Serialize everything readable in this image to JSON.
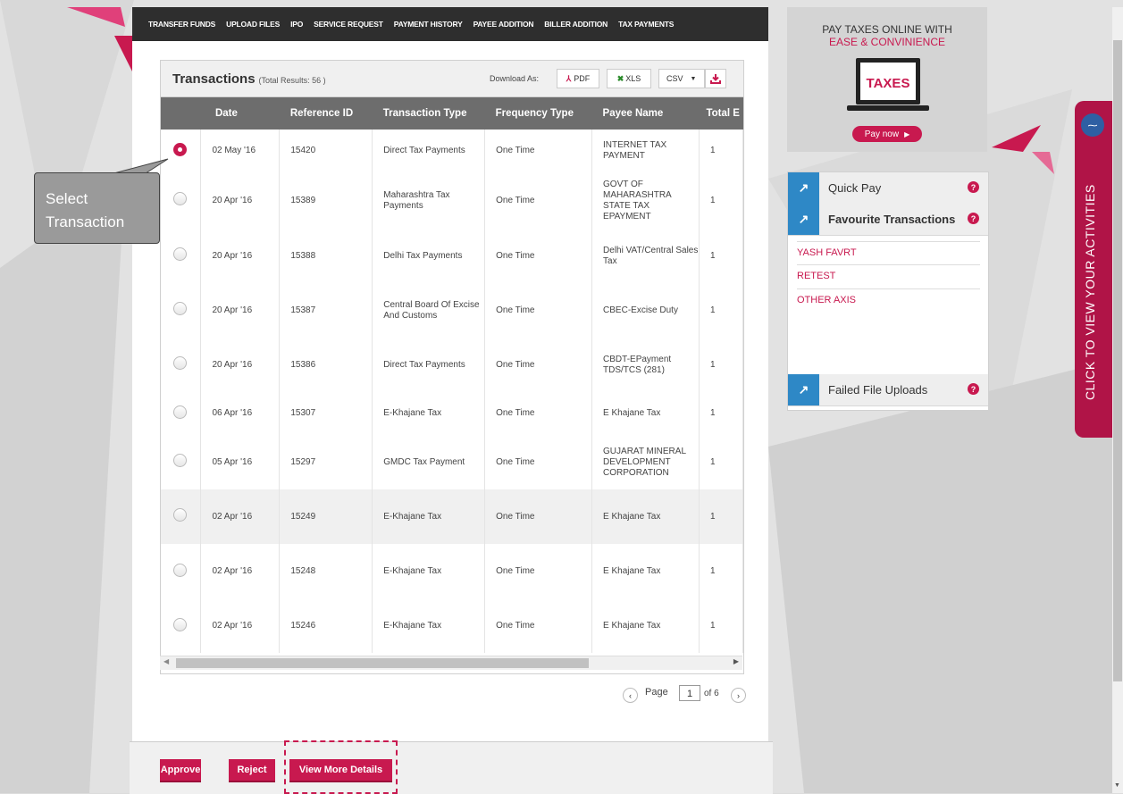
{
  "nav": {
    "items": [
      "TRANSFER FUNDS",
      "UPLOAD FILES",
      "IPO",
      "SERVICE REQUEST",
      "PAYMENT HISTORY",
      "PAYEE ADDITION",
      "BILLER ADDITION",
      "TAX PAYMENTS"
    ],
    "active": "TAX PAYMENTS"
  },
  "transactions": {
    "title": "Transactions",
    "count_label": "(Total Results: 56 )",
    "download_label": "Download As:",
    "pdf_label": "PDF",
    "xls_label": "XLS",
    "csv_label": "CSV",
    "columns": [
      "Date",
      "Reference ID",
      "Transaction Type",
      "Frequency Type",
      "Payee Name",
      "Total E"
    ],
    "rows": [
      {
        "date": "02 May '16",
        "ref": "15420",
        "type": "Direct Tax Payments",
        "freq": "One Time",
        "payee": "INTERNET TAX PAYMENT",
        "total": "1",
        "selected": true
      },
      {
        "date": "20 Apr '16",
        "ref": "15389",
        "type": "Maharashtra Tax Payments",
        "freq": "One Time",
        "payee": "GOVT OF MAHARASHTRA STATE TAX EPAYMENT",
        "total": "1",
        "selected": false
      },
      {
        "date": "20 Apr '16",
        "ref": "15388",
        "type": "Delhi Tax Payments",
        "freq": "One Time",
        "payee": "Delhi VAT/Central Sales Tax",
        "total": "1",
        "selected": false
      },
      {
        "date": "20 Apr '16",
        "ref": "15387",
        "type": "Central Board Of Excise And Customs",
        "freq": "One Time",
        "payee": "CBEC-Excise Duty",
        "total": "1",
        "selected": false
      },
      {
        "date": "20 Apr '16",
        "ref": "15386",
        "type": "Direct Tax Payments",
        "freq": "One Time",
        "payee": "CBDT-EPayment TDS/TCS (281)",
        "total": "1",
        "selected": false
      },
      {
        "date": "06 Apr '16",
        "ref": "15307",
        "type": "E-Khajane Tax",
        "freq": "One Time",
        "payee": "E Khajane Tax",
        "total": "1",
        "selected": false
      },
      {
        "date": "05 Apr '16",
        "ref": "15297",
        "type": "GMDC Tax Payment",
        "freq": "One Time",
        "payee": "GUJARAT MINERAL DEVELOPMENT CORPORATION",
        "total": "1",
        "selected": false
      },
      {
        "date": "02 Apr '16",
        "ref": "15249",
        "type": "E-Khajane Tax",
        "freq": "One Time",
        "payee": "E Khajane Tax",
        "total": "1",
        "selected": false
      },
      {
        "date": "02 Apr '16",
        "ref": "15248",
        "type": "E-Khajane Tax",
        "freq": "One Time",
        "payee": "E Khajane Tax",
        "total": "1",
        "selected": false
      },
      {
        "date": "02 Apr '16",
        "ref": "15246",
        "type": "E-Khajane Tax",
        "freq": "One Time",
        "payee": "E Khajane Tax",
        "total": "1",
        "selected": false
      }
    ]
  },
  "pager": {
    "label": "Page",
    "current": "1",
    "of_label": "of 6"
  },
  "actions": {
    "approve": "Approve",
    "reject": "Reject",
    "details": "View More Details"
  },
  "callout": {
    "line1": "Select",
    "line2": "Transaction"
  },
  "ad": {
    "line1": "PAY TAXES ONLINE WITH",
    "line2": "EASE & CONVINIENCE",
    "screen_text": "TAXES",
    "cta": "Pay now"
  },
  "quick": {
    "quick_pay": "Quick Pay",
    "favourites": "Favourite Transactions",
    "fav_items": [
      "YASH FAVRT",
      "RETEST",
      "OTHER AXIS"
    ],
    "failed": "Failed File Uploads",
    "help": "?"
  },
  "activity": {
    "label": "CLICK TO VIEW YOUR ACTIVITIES"
  },
  "colors": {
    "brand": "#c8194f",
    "header_dark": "#2e2e2e",
    "table_head": "#6d6d6d",
    "tile_blue": "#2e88c6"
  }
}
